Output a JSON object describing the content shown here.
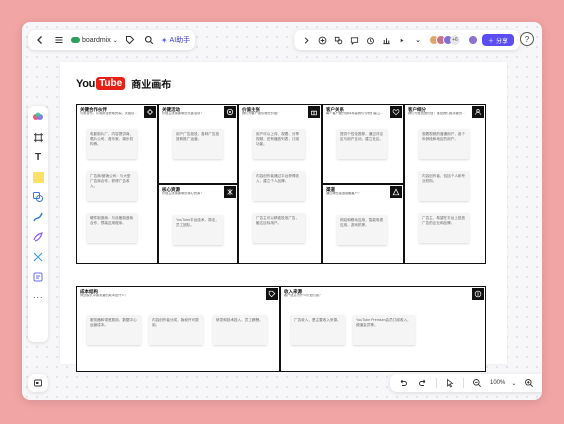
{
  "app": {
    "brand_name": "boardmix",
    "ai_label": "AI助手",
    "share_label": "分享",
    "avatar_count": "+6",
    "zoom": "100%",
    "colors": {
      "background": "#f2a5a5",
      "accent": "#5b4df0",
      "youtube_red": "#e62117"
    }
  },
  "toolbar_left": {
    "icons": [
      "back-icon",
      "menu-icon",
      "tag-icon",
      "search-icon"
    ]
  },
  "toolbar_right": {
    "icons": [
      "arrow-icon",
      "add-icon",
      "shape-icon",
      "comment-icon",
      "timer-icon",
      "vote-icon",
      "presentation-icon",
      "more-icon"
    ]
  },
  "left_tools": [
    "color-palette",
    "frame",
    "text",
    "sticky-note",
    "shape",
    "pen",
    "brush",
    "connector",
    "template",
    "more"
  ],
  "canvas": {
    "logo_you": "You",
    "logo_tube": "Tube",
    "title": "商业画布"
  },
  "boxes": {
    "partners": {
      "title": "关键合作伙伴",
      "subtitle": "与谁合作，从谁那里获取资源，关键合作伙伴是谁？",
      "notes": [
        "电影制片厂、内容提供商、唱片公司、音乐家，娱乐机构等。",
        "广告商/营销公司：与大型广告商合作，获得广告收入。",
        "硬件制造商：与设备制造商合作，预装应用程序。"
      ]
    },
    "activities": {
      "title": "关键活动",
      "subtitle": "价值主张需要哪些关键活动？",
      "notes": [
        "用户广告投放，各种广告投放和推广运营。"
      ]
    },
    "resources": {
      "title": "核心资源",
      "subtitle": "价值主张需要哪些核心资源？",
      "notes": [
        "YouTube平台技术，算法，员工团队。"
      ]
    },
    "value": {
      "title": "价值主张",
      "subtitle": "我们为客户提供哪些价值？",
      "notes": [
        "用户可以上传、观看、分享视频，还有播放列表，订阅功能。",
        "内容创作者通过平台获得收入，建立个人品牌。",
        "广告主可以精准投放广告，触达目标用户。"
      ]
    },
    "relationships": {
      "title": "客户关系",
      "subtitle": "每个客户细分群体希望我们与他们建立怎样的关系？",
      "notes": [
        "提供个性化推荐，通过评论区与用户互动，建立社区。"
      ]
    },
    "channels": {
      "title": "渠道",
      "subtitle": "通过哪些渠道接触客户？",
      "notes": [
        "网站和移动应用，智能电视应用，游戏机等。"
      ]
    },
    "segments": {
      "title": "客户细分",
      "subtitle": "我们为谁创造价值？谁是我们最重要的客户？",
      "notes": [
        "观看视频的普通用户，各个年龄段和地区的用户。",
        "内容创作者，包括个人和专业机构。",
        "广告主，希望在平台上投放广告的企业和品牌。"
      ]
    },
    "costs": {
      "title": "成本结构",
      "subtitle": "商业模式中最重要的成本是什么？",
      "notes": [
        "服务器和带宽费用，数据中心运营成本。",
        "内容创作者分成，版权许可费用。",
        "研发和技术投入，员工薪酬。"
      ]
    },
    "revenue": {
      "title": "收入来源",
      "subtitle": "客户愿意为什么价值付费？",
      "notes": [
        "广告收入，是主要收入来源。",
        "YouTube Premium会员订阅收入，频道会员等。"
      ]
    }
  }
}
